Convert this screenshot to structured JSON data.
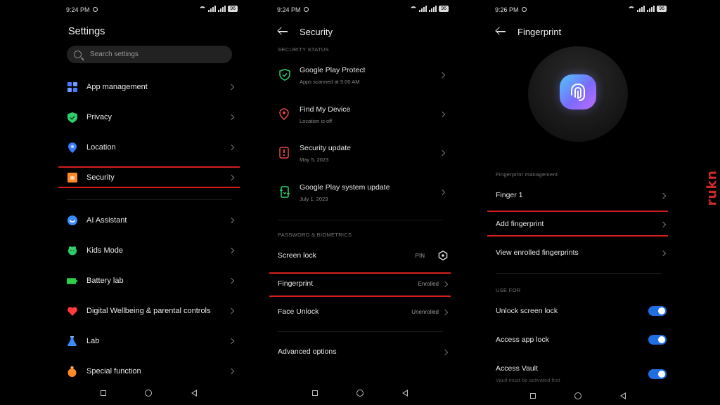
{
  "status": {
    "p1_time": "9:24 PM",
    "p2_time": "9:24 PM",
    "p3_time": "9:26 PM",
    "battery": "96"
  },
  "panel1": {
    "title": "Settings",
    "search_placeholder": "Search settings",
    "items": [
      {
        "label": "App management",
        "icon": "app-grid-icon",
        "color": "#4a7bff"
      },
      {
        "label": "Privacy",
        "icon": "shield-icon",
        "color": "#2fcf6a"
      },
      {
        "label": "Location",
        "icon": "location-pin-icon",
        "color": "#3a7bff"
      },
      {
        "label": "Security",
        "icon": "security-icon",
        "color": "#ff8a2a"
      },
      {
        "label": "AI Assistant",
        "icon": "ai-assistant-icon",
        "color": "#3a8cff"
      },
      {
        "label": "Kids Mode",
        "icon": "kids-mode-icon",
        "color": "#2fcf6a"
      },
      {
        "label": "Battery lab",
        "icon": "battery-icon",
        "color": "#2fcf4a"
      },
      {
        "label": "Digital Wellbeing & parental controls",
        "icon": "heart-icon",
        "color": "#ff3b3b"
      },
      {
        "label": "Lab",
        "icon": "flask-icon",
        "color": "#3a8cff"
      },
      {
        "label": "Special function",
        "icon": "special-function-icon",
        "color": "#ff8a2a"
      }
    ]
  },
  "panel2": {
    "title": "Security",
    "section_status": "SECURITY STATUS",
    "status_items": [
      {
        "title": "Google Play Protect",
        "sub": "Apps scanned at 5:00 AM",
        "icon": "play-protect-icon",
        "color": "#2fcf6a"
      },
      {
        "title": "Find My Device",
        "sub": "Location is off",
        "icon": "find-device-icon",
        "color": "#e64545"
      },
      {
        "title": "Security update",
        "sub": "May 5, 2023",
        "icon": "security-update-icon",
        "color": "#e64545"
      },
      {
        "title": "Google Play system update",
        "sub": "July 1, 2023",
        "icon": "system-update-icon",
        "color": "#2fcf6a"
      }
    ],
    "section_biometrics": "PASSWORD & BIOMETRICS",
    "screen_lock": {
      "label": "Screen lock",
      "value": "PIN"
    },
    "fingerprint": {
      "label": "Fingerprint",
      "value": "Enrolled"
    },
    "face_unlock": {
      "label": "Face Unlock",
      "value": "Unenrolled"
    },
    "advanced": {
      "label": "Advanced options"
    }
  },
  "panel3": {
    "title": "Fingerprint",
    "section_management": "Fingerprint management",
    "finger1": "Finger 1",
    "add": "Add fingerprint",
    "view": "View enrolled fingerprints",
    "section_use": "USE FOR",
    "toggles": [
      {
        "label": "Unlock screen lock",
        "on": true
      },
      {
        "label": "Access app lock",
        "on": true
      },
      {
        "label": "Access Vault",
        "sub": "Vault must be activated first",
        "on": true
      }
    ]
  },
  "watermark": "rukn",
  "colors": {
    "highlight": "#d41e1e",
    "toggle": "#1f6fe0"
  }
}
